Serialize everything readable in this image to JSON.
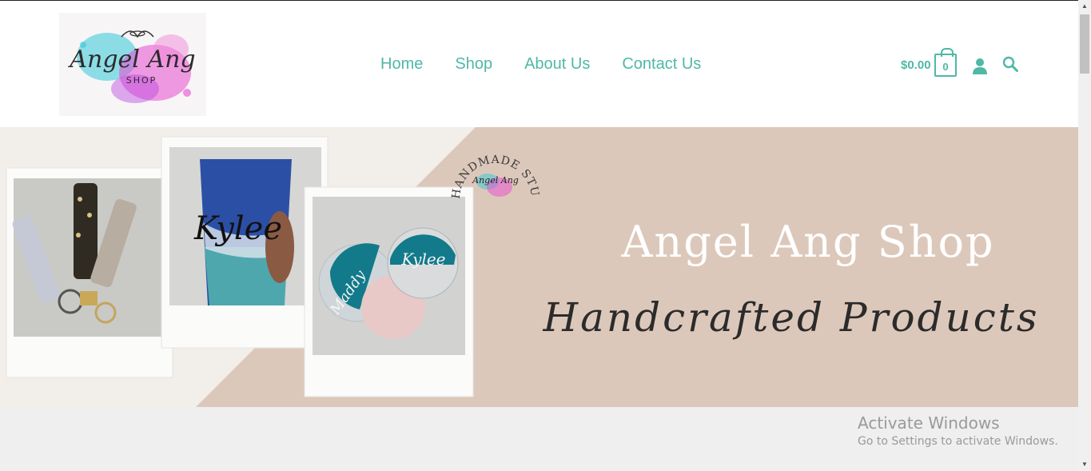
{
  "header": {
    "logo": {
      "script_text": "Angel Ang",
      "small_text": "SHOP"
    },
    "nav": [
      {
        "label": "Home"
      },
      {
        "label": "Shop"
      },
      {
        "label": "About Us"
      },
      {
        "label": "Contact Us"
      }
    ],
    "cart": {
      "total": "$0.00",
      "count": "0"
    },
    "icons": {
      "account": "user-icon",
      "search": "search-icon",
      "cart": "shopping-bag-icon"
    }
  },
  "hero": {
    "title": "Angel Ang Shop",
    "subtitle": "Handcrafted Products",
    "badge_text": "HANDMADE STUDIO",
    "badge_logo_text": "Angel Ang",
    "photo_tumbler_text": "Kylee",
    "photo_coaster_texts": [
      "Maddy",
      "Kylee"
    ]
  },
  "watermark": {
    "title": "Activate Windows",
    "subtitle": "Go to Settings to activate Windows."
  },
  "colors": {
    "accent": "#4fb8a6",
    "hero_bg": "#dcc8ba",
    "hero_light": "#f2efea"
  }
}
